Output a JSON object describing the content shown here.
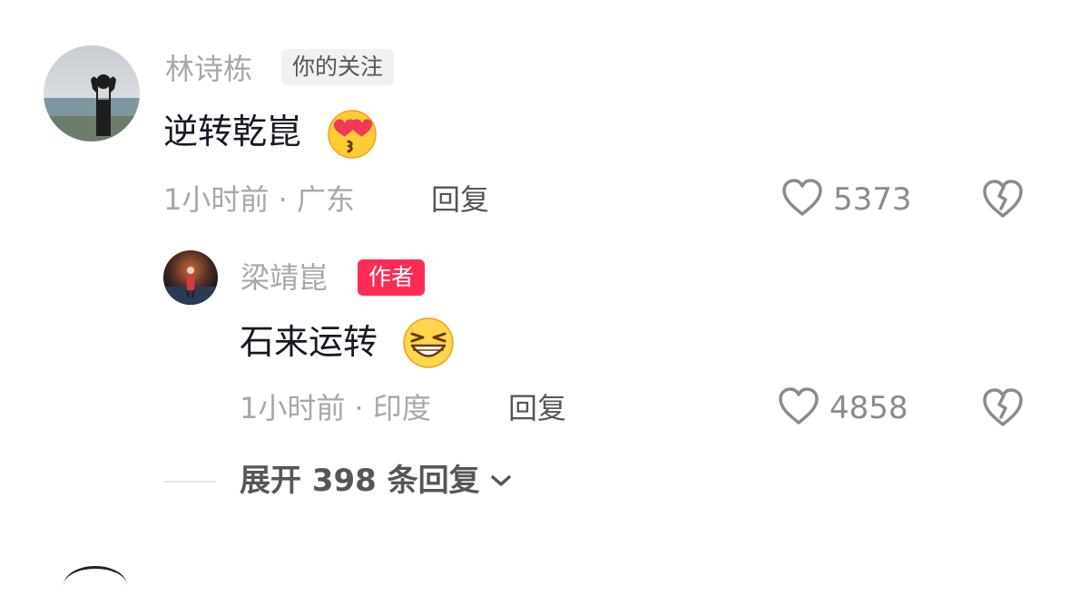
{
  "comment": {
    "avatar_icon": "avatar-beach-person",
    "username": "林诗栋",
    "badge": "你的关注",
    "text": "逆转乾崑",
    "emoji": "kissing-heart-eyes-emoji",
    "meta": "1小时前 · 广东",
    "reply_label": "回复",
    "like_count": "5373",
    "like_icon": "heart-outline-icon",
    "dislike_icon": "broken-heart-icon",
    "accent": "#fe2c55"
  },
  "reply": {
    "avatar_icon": "avatar-stage-person",
    "username": "梁靖崑",
    "badge": "作者",
    "text": "石来运转",
    "emoji": "grinning-squint-emoji",
    "meta": "1小时前 · 印度",
    "reply_label": "回复",
    "like_count": "4858"
  },
  "expand": {
    "label": "展开 398 条回复",
    "icon": "chevron-down-icon"
  }
}
